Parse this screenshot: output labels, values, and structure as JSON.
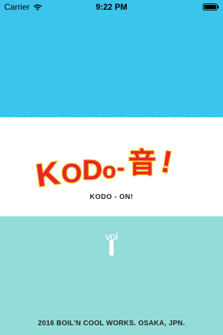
{
  "status_bar": {
    "carrier": "Carrier",
    "time": "9:22 PM",
    "signal_icon": "wifi-icon",
    "battery_icon": "battery-icon"
  },
  "logo": {
    "letters": [
      "K",
      "O",
      "D",
      "o",
      "-",
      "音",
      "!"
    ],
    "subtitle": "KODO - ON!"
  },
  "volume": {
    "label": "vol",
    "level_icon": "volume-bar"
  },
  "footer": {
    "credit": "2016 BOIL'N COOL WORKS. OSAKA, JPN."
  },
  "colors": {
    "top_band": "#3cc5ec",
    "bottom_band": "#94dcda",
    "logo_fill": "#e8262d",
    "logo_outline": "#f5c71a"
  }
}
